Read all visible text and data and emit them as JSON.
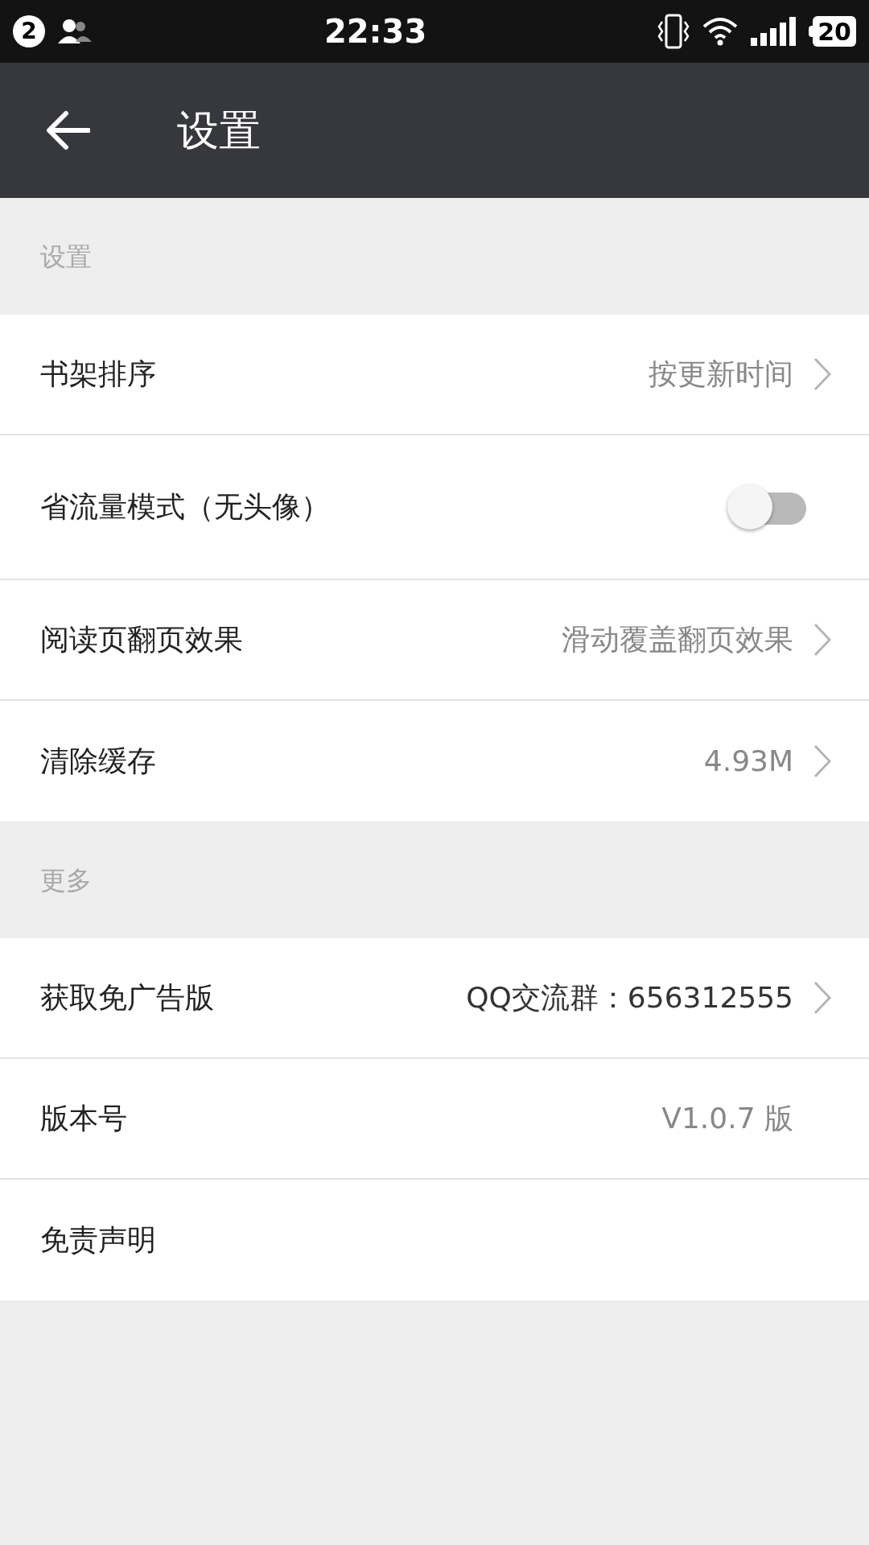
{
  "status_bar": {
    "notification_count": "2",
    "time": "22:33",
    "battery": "20"
  },
  "toolbar": {
    "title": "设置"
  },
  "sections": [
    {
      "header": "设置",
      "rows": [
        {
          "kind": "value",
          "label": "书架排序",
          "value": "按更新时间",
          "emphasized": false,
          "chevron": true
        },
        {
          "kind": "toggle",
          "label": "省流量模式（无头像）",
          "on": false
        },
        {
          "kind": "value",
          "label": "阅读页翻页效果",
          "value": "滑动覆盖翻页效果",
          "emphasized": false,
          "chevron": true
        },
        {
          "kind": "value",
          "label": "清除缓存",
          "value": "4.93M",
          "emphasized": false,
          "chevron": true
        }
      ]
    },
    {
      "header": "更多",
      "rows": [
        {
          "kind": "value",
          "label": "获取免广告版",
          "value": "QQ交流群：656312555",
          "emphasized": true,
          "chevron": true
        },
        {
          "kind": "value",
          "label": "版本号",
          "value": "V1.0.7 版",
          "emphasized": false,
          "chevron": false
        },
        {
          "kind": "plain",
          "label": "免责声明"
        }
      ]
    }
  ]
}
